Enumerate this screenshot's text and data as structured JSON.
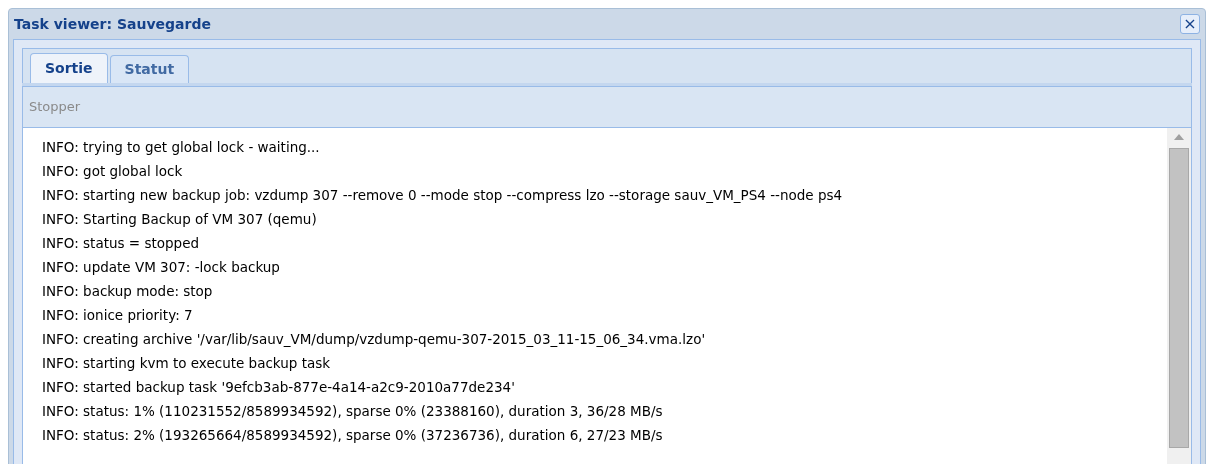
{
  "window": {
    "title": "Task viewer: Sauvegarde",
    "close": "×"
  },
  "tabs": [
    {
      "label": "Sortie",
      "selected": true
    },
    {
      "label": "Statut",
      "selected": false
    }
  ],
  "toolbar": {
    "stop_button": {
      "label": "Stopper",
      "disabled": true
    }
  },
  "log": [
    "INFO: trying to get global lock - waiting...",
    "INFO: got global lock",
    "INFO: starting new backup job: vzdump 307 --remove 0 --mode stop --compress lzo --storage sauv_VM_PS4 --node ps4",
    "INFO: Starting Backup of VM 307 (qemu)",
    "INFO: status = stopped",
    "INFO: update VM 307: -lock backup",
    "INFO: backup mode: stop",
    "INFO: ionice priority: 7",
    "INFO: creating archive '/var/lib/sauv_VM/dump/vzdump-qemu-307-2015_03_11-15_06_34.vma.lzo'",
    "INFO: starting kvm to execute backup task",
    "INFO: started backup task '9efcb3ab-877e-4a14-a2c9-2010a77de234'",
    "INFO: status: 1% (110231552/8589934592), sparse 0% (23388160), duration 3, 36/28 MB/s",
    "INFO: status: 2% (193265664/8589934592), sparse 0% (37236736), duration 6, 27/23 MB/s"
  ]
}
